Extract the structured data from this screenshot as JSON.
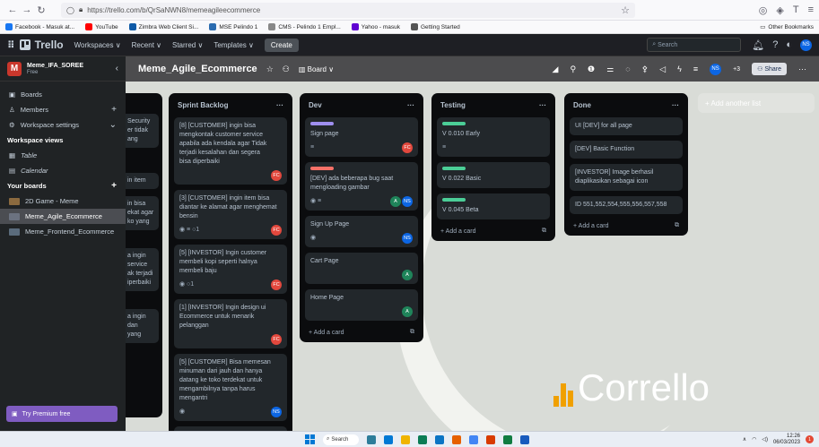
{
  "browser": {
    "url": "https://trello.com/b/QrSaNWN8/memeagileecommerce",
    "bookmarks": [
      {
        "label": "Facebook - Masuk at...",
        "color": "#1877f2"
      },
      {
        "label": "YouTube",
        "color": "#ff0000"
      },
      {
        "label": "Zimbra Web Client Si...",
        "color": "#0e5aa7"
      },
      {
        "label": "MSE Pelindo 1",
        "color": "#2b6cb0"
      },
      {
        "label": "CMS - Pelindo 1 Empl...",
        "color": "#888888"
      },
      {
        "label": "Yahoo - masuk",
        "color": "#6001d2"
      },
      {
        "label": "Getting Started",
        "color": "#555555"
      }
    ],
    "other_bookmarks": "Other Bookmarks"
  },
  "topbar": {
    "brand": "Trello",
    "menus": [
      "Workspaces ∨",
      "Recent ∨",
      "Starred ∨",
      "Templates ∨"
    ],
    "create": "Create",
    "search_placeholder": "Search",
    "avatar_initials": "NS"
  },
  "sidebar": {
    "workspace_initial": "M",
    "workspace_name": "Meme_IFA_SOREE",
    "workspace_plan": "Free",
    "items": [
      {
        "label": "Boards",
        "icon": "boards-icon"
      },
      {
        "label": "Members",
        "icon": "members-icon"
      },
      {
        "label": "Workspace settings",
        "icon": "gear-icon"
      }
    ],
    "views_title": "Workspace views",
    "views": [
      "Table",
      "Calendar"
    ],
    "your_boards_title": "Your boards",
    "boards": [
      {
        "label": "2D Game - Meme",
        "color": "#8b6a3f"
      },
      {
        "label": "Meme_Agile_Ecommerce",
        "color": "#6b7280"
      },
      {
        "label": "Meme_Frontend_Ecommerce",
        "color": "#5a6b7c"
      }
    ],
    "premium": "Try Premium free"
  },
  "board": {
    "title": "Meme_Agile_Ecommerce",
    "view": "Board ∨",
    "member_count": "+3",
    "share": "Share"
  },
  "partial_list": {
    "fragments": [
      [
        "Security",
        "er tidak",
        "ang"
      ],
      [
        "in item"
      ],
      [
        "in bisa",
        "ekat agar",
        "ko yang"
      ],
      [
        "a ingin",
        "service",
        "ak terjadi",
        "iperbaiki"
      ],
      [
        "a ingin",
        "dan",
        "yang"
      ]
    ]
  },
  "lists": [
    {
      "title": "Sprint Backlog",
      "cards": [
        {
          "text": "[8] [CUSTOMER] ingin bisa mengkontak customer service apabila ada kendala agar Tidak terjadi kesalahan dan segera bisa diperbaiki",
          "labels": [],
          "meta": "",
          "members": [
            {
              "i": "FC",
              "c": "#e2483d"
            }
          ]
        },
        {
          "text": "[3] [CUSTOMER] ingin item bisa diantar ke alamat agar menghemat bensin",
          "labels": [],
          "meta": "◉ ≡ ○1",
          "members": [
            {
              "i": "FC",
              "c": "#e2483d"
            }
          ]
        },
        {
          "text": "[5] [INVESTOR] Ingin customer membeli kopi seperti halnya membeli baju",
          "labels": [],
          "meta": "◉ ○1",
          "members": [
            {
              "i": "FC",
              "c": "#e2483d"
            }
          ]
        },
        {
          "text": "[1] [INVESTOR] Ingin design ui Ecommerce untuk menarik pelanggan",
          "labels": [],
          "meta": "",
          "members": [
            {
              "i": "FC",
              "c": "#e2483d"
            }
          ]
        },
        {
          "text": "[5] [CUSTOMER] Bisa memesan minuman dari jauh dan hanya datang ke toko terdekat untuk mengambilnya tanpa harus mengantri",
          "labels": [],
          "meta": "◉",
          "members": [
            {
              "i": "NS",
              "c": "#0c66e4"
            }
          ]
        },
        {
          "text": "",
          "labels": [
            "#e2b203",
            "#f87168"
          ],
          "meta": "",
          "members": []
        }
      ],
      "add": "+ Add a card"
    },
    {
      "title": "Dev",
      "cards": [
        {
          "text": "Sign page",
          "labels": [
            "#9f8fef"
          ],
          "meta": "≡",
          "members": [
            {
              "i": "FC",
              "c": "#e2483d"
            }
          ]
        },
        {
          "text": "[DEV] ada beberapa bug saat mengloading gambar",
          "labels": [
            "#f87168"
          ],
          "meta": "◉ ≡",
          "members": [
            {
              "i": "A",
              "c": "#1f845a"
            },
            {
              "i": "NS",
              "c": "#0c66e4"
            }
          ]
        },
        {
          "text": "Sign Up Page",
          "labels": [],
          "meta": "◉",
          "members": [
            {
              "i": "NS",
              "c": "#0c66e4"
            }
          ]
        },
        {
          "text": "Cart Page",
          "labels": [],
          "meta": "",
          "members": [
            {
              "i": "A",
              "c": "#1f845a"
            }
          ]
        },
        {
          "text": "Home Page",
          "labels": [],
          "meta": "",
          "members": [
            {
              "i": "A",
              "c": "#1f845a"
            }
          ]
        }
      ],
      "add": "+ Add a card"
    },
    {
      "title": "Testing",
      "cards": [
        {
          "text": "V 0.010 Early",
          "labels": [
            "#4bce97"
          ],
          "meta": "≡",
          "members": []
        },
        {
          "text": "V 0.022 Basic",
          "labels": [
            "#4bce97"
          ],
          "meta": "",
          "members": []
        },
        {
          "text": "V 0.045 Beta",
          "labels": [
            "#4bce97"
          ],
          "meta": "",
          "members": []
        }
      ],
      "add": "+ Add a card"
    },
    {
      "title": "Done",
      "cards": [
        {
          "text": "UI [DEV] for all page",
          "labels": [],
          "meta": "",
          "members": []
        },
        {
          "text": "[DEV] Basic Function",
          "labels": [],
          "meta": "",
          "members": []
        },
        {
          "text": "[INVESTOR] Image berhasil diaplikasikan sebagai icon",
          "labels": [],
          "meta": "",
          "members": []
        },
        {
          "text": "ID 551,552,554,555,556,557,558",
          "labels": [],
          "meta": "",
          "members": []
        }
      ],
      "add": "+ Add a card"
    }
  ],
  "add_list": "+ Add another list",
  "watermark": "Corrello",
  "taskbar": {
    "search": "Search",
    "time": "12:26",
    "date": "06/03/2023",
    "notif": "1"
  }
}
